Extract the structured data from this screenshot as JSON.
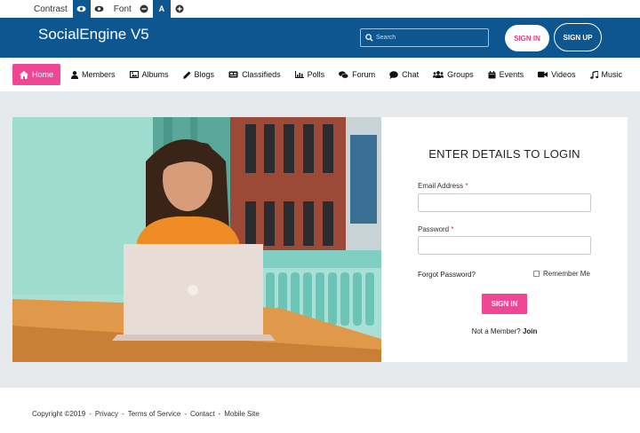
{
  "accessibility": {
    "contrast_label": "Contrast",
    "font_label": "Font",
    "font_reset_label": "A"
  },
  "header": {
    "brand": "SocialEngine V5",
    "search_placeholder": "Search",
    "signin_label": "SIGN IN",
    "signup_label": "SIGN UP"
  },
  "nav": {
    "items": [
      {
        "label": "Home",
        "icon": "home-icon",
        "active": true
      },
      {
        "label": "Members",
        "icon": "user-icon"
      },
      {
        "label": "Albums",
        "icon": "image-icon"
      },
      {
        "label": "Blogs",
        "icon": "pencil-icon"
      },
      {
        "label": "Classifieds",
        "icon": "newspaper-icon"
      },
      {
        "label": "Polls",
        "icon": "bar-chart-icon"
      },
      {
        "label": "Forum",
        "icon": "comments-icon"
      },
      {
        "label": "Chat",
        "icon": "chat-bubble-icon"
      },
      {
        "label": "Groups",
        "icon": "users-icon"
      },
      {
        "label": "Events",
        "icon": "calendar-icon"
      },
      {
        "label": "Videos",
        "icon": "video-camera-icon"
      },
      {
        "label": "Music",
        "icon": "music-note-icon"
      }
    ]
  },
  "login": {
    "title": "ENTER DETAILS TO LOGIN",
    "email_label": "Email Address",
    "password_label": "Password",
    "required_mark": "*",
    "forgot_label": "Forgot Password?",
    "remember_label": "Remember Me",
    "signin_label": "SIGN IN",
    "not_member_text": "Not a Member?",
    "join_label": "Join"
  },
  "footer": {
    "copyright": "Copyright ©2019",
    "separator": "-",
    "links": [
      "Privacy",
      "Terms of Service",
      "Contact",
      "Mobile Site"
    ]
  },
  "colors": {
    "header_bg": "#0e568f",
    "accent_pink": "#ef4696",
    "content_bg": "#e6eaed"
  }
}
